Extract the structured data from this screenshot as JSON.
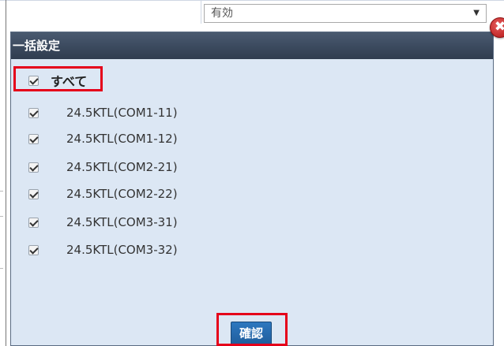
{
  "background": {
    "select_value": "有効",
    "select_arrow": "▼"
  },
  "dialog": {
    "title": "一括設定",
    "close_symbol": "✖",
    "select_all_label": "すべて",
    "items": [
      {
        "label": "24.5KTL(COM1-11)",
        "checked": true
      },
      {
        "label": "24.5KTL(COM1-12)",
        "checked": true
      },
      {
        "label": "24.5KTL(COM2-21)",
        "checked": true
      },
      {
        "label": "24.5KTL(COM2-22)",
        "checked": true
      },
      {
        "label": "24.5KTL(COM3-31)",
        "checked": true
      },
      {
        "label": "24.5KTL(COM3-32)",
        "checked": true
      }
    ],
    "confirm_label": "確認"
  },
  "colors": {
    "header": "#3b4a60",
    "modal_bg": "#dce7f4",
    "highlight": "#e5001a",
    "confirm": "#2468ad",
    "close": "#c62828"
  }
}
